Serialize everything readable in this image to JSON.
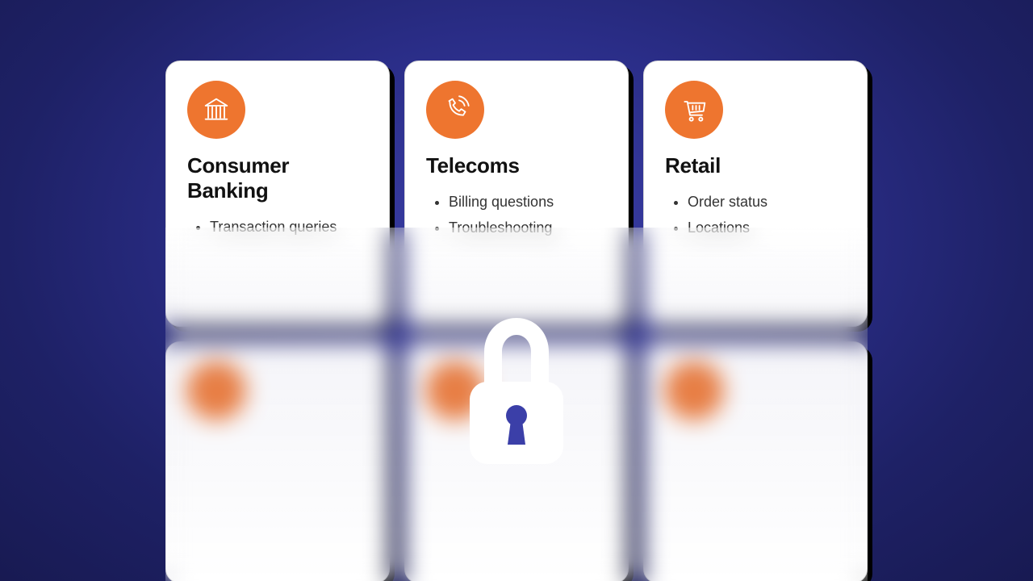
{
  "colors": {
    "accent": "#ee752f",
    "cardBg": "#ffffff",
    "pageBg": "#2a2d87"
  },
  "cards": [
    {
      "icon": "bank-icon",
      "title": "Consumer Banking",
      "items": [
        "Transaction queries"
      ]
    },
    {
      "icon": "phone-icon",
      "title": "Telecoms",
      "items": [
        "Billing questions",
        "Troubleshooting"
      ]
    },
    {
      "icon": "cart-icon",
      "title": "Retail",
      "items": [
        "Order status",
        "Locations"
      ]
    }
  ],
  "overlay": {
    "icon": "lock-icon",
    "state": "locked"
  }
}
